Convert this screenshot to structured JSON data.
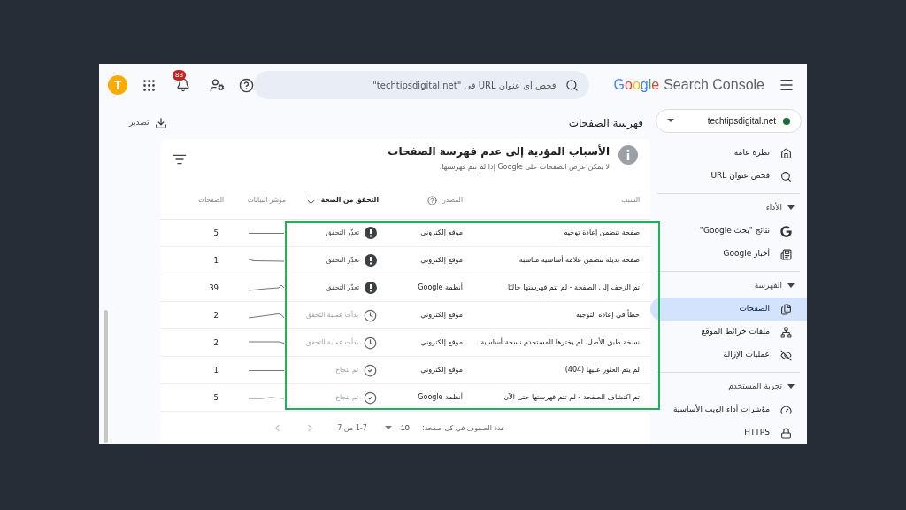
{
  "header": {
    "logo": {
      "brand": "Google",
      "product": "Search Console"
    },
    "search": {
      "placeholder": "فحص أي عنوان URL في \"techtipsdigital.net\""
    },
    "notifications": {
      "count": "83"
    },
    "avatar": {
      "letter": "T"
    }
  },
  "property": {
    "name": "techtipsdigital.net"
  },
  "sidebar": {
    "groups": [
      {
        "items": [
          {
            "label": "نظرة عامة",
            "selected": false
          },
          {
            "label": "فحص عنوان URL",
            "selected": false
          }
        ]
      },
      {
        "title": "الأداء",
        "expanded": true,
        "items": [
          {
            "label": "نتائج \"بحث Google\"",
            "selected": false
          },
          {
            "label": "أخبار Google",
            "selected": false
          }
        ]
      },
      {
        "title": "الفهرسة",
        "expanded": true,
        "items": [
          {
            "label": "الصفحات",
            "selected": true
          },
          {
            "label": "ملفات خرائط الموقع",
            "selected": false
          },
          {
            "label": "عمليات الإزالة",
            "selected": false
          }
        ]
      },
      {
        "title": "تجربة المستخدم",
        "expanded": true,
        "items": [
          {
            "label": "مؤشرات أداء الويب الأساسية",
            "selected": false
          },
          {
            "label": "HTTPS",
            "selected": false
          }
        ]
      }
    ]
  },
  "page": {
    "title": "فهرسة الصفحات",
    "export": "تصدير"
  },
  "card": {
    "title": "الأسباب المؤدية إلى عدم فهرسة الصفحات",
    "subtitle": "لا يمكن عرض الصفحات على Google إذا لم تتم فهرستها.",
    "columns": [
      {
        "label": "السبب",
        "sorted": false,
        "help": false
      },
      {
        "label": "المصدر",
        "sorted": false,
        "help": true
      },
      {
        "label": "التحقق من الصحة",
        "sorted": true,
        "help": false
      },
      {
        "label": "مؤشر البيانات",
        "sorted": false,
        "help": false
      },
      {
        "label": "الصفحات",
        "sorted": false,
        "help": false
      }
    ],
    "rows_highlighted": true,
    "rows": [
      {
        "reason": "صفحة تتضمن إعادة توجيه",
        "source": "موقع إلكتروني",
        "validation": {
          "kind": "failed",
          "label": "تعذّر التحقق"
        },
        "pages": "5"
      },
      {
        "reason": "صفحة بديلة تتضمن علامة أساسية مناسبة",
        "source": "موقع إلكتروني",
        "validation": {
          "kind": "failed",
          "label": "تعذّر التحقق"
        },
        "pages": "1"
      },
      {
        "reason": "تم الزحف إلى الصفحة - لم تتم فهرستها حاليًا",
        "source": "أنظمة Google",
        "validation": {
          "kind": "failed",
          "label": "تعذّر التحقق"
        },
        "pages": "39"
      },
      {
        "reason": "خطأ في إعادة التوجيه",
        "source": "موقع إلكتروني",
        "validation": {
          "kind": "started",
          "label": "بدأت عملية التحقق"
        },
        "pages": "2"
      },
      {
        "reason": "نسخة طبق الأصل، لم يخترها المستخدم نسخة أساسية.",
        "source": "موقع إلكتروني",
        "validation": {
          "kind": "started",
          "label": "بدأت عملية التحقق"
        },
        "pages": "2"
      },
      {
        "reason": "لم يتم العثور عليها (404)",
        "source": "موقع إلكتروني",
        "validation": {
          "kind": "passed",
          "label": "تم بنجاح"
        },
        "pages": "1"
      },
      {
        "reason": "تم اكتشاف الصفحة - لم تتم فهرستها حتى الآن",
        "source": "أنظمة Google",
        "validation": {
          "kind": "passed",
          "label": "تم بنجاح"
        },
        "pages": "5"
      }
    ],
    "footer": {
      "rows_per_page_label": "عدد الصفوف في كل صفحة:",
      "rows_per_page": "10",
      "range": "1-7 من 7",
      "prev_disabled": true,
      "next_disabled": true
    }
  }
}
